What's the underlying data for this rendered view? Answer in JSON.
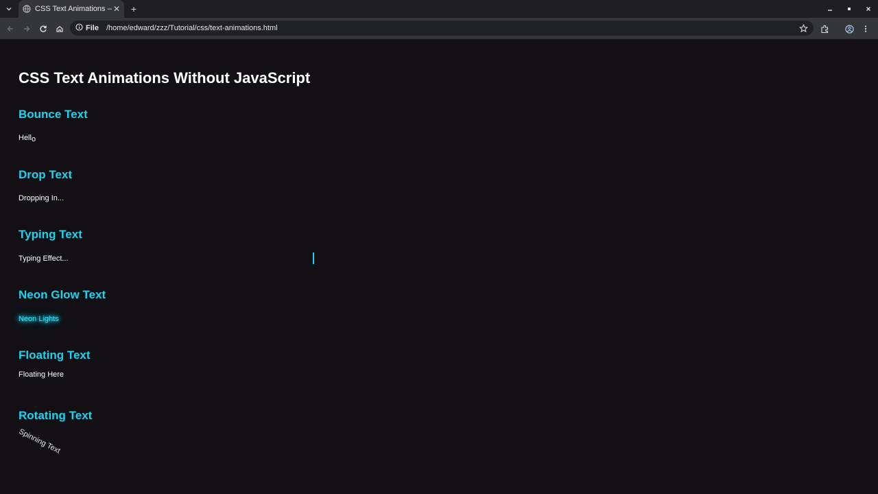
{
  "browser": {
    "tab_title": "CSS Text Animations – ",
    "site_info_label": "File",
    "url": "/home/edward/zzz/Tutorial/css/text-animations.html"
  },
  "page": {
    "title": "CSS Text Animations Without JavaScript",
    "accent_color": "#1dd3f0",
    "sections": [
      {
        "heading": "Bounce Text",
        "text_main": "Hell",
        "text_last": "o"
      },
      {
        "heading": "Drop Text",
        "text": "Dropping In..."
      },
      {
        "heading": "Typing Text",
        "text": "Typing Effect..."
      },
      {
        "heading": "Neon Glow Text",
        "text": "Neon Lights"
      },
      {
        "heading": "Floating Text",
        "text": "Floating Here"
      },
      {
        "heading": "Rotating Text",
        "text": "Spinning Text"
      }
    ]
  }
}
